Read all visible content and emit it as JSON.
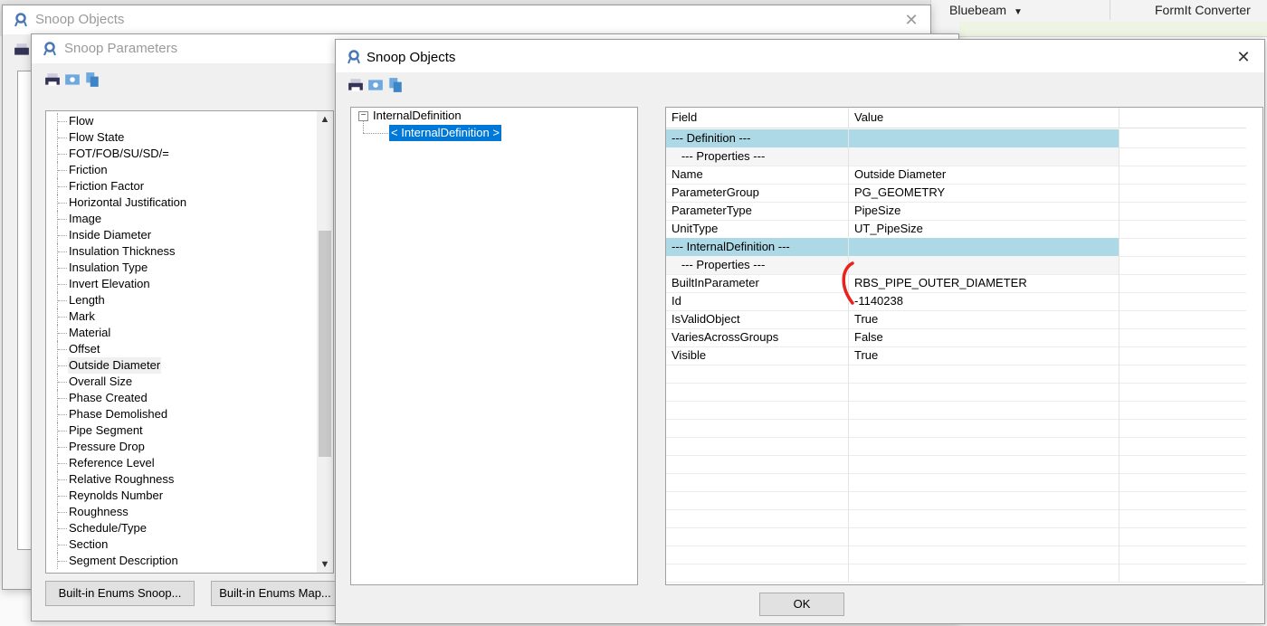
{
  "background": {
    "ribbon_tabs": [
      "Bluebeam",
      "FormIt Converter"
    ]
  },
  "back_window": {
    "title": "Snoop Objects",
    "close": "✕"
  },
  "params_window": {
    "title": "Snoop Parameters",
    "items": [
      "Flow",
      "Flow State",
      "FOT/FOB/SU/SD/=",
      "Friction",
      "Friction Factor",
      "Horizontal Justification",
      "Image",
      "Inside Diameter",
      "Insulation Thickness",
      "Insulation Type",
      "Invert Elevation",
      "Length",
      "Mark",
      "Material",
      "Offset",
      "Outside Diameter",
      "Overall Size",
      "Phase Created",
      "Phase Demolished",
      "Pipe Segment",
      "Pressure Drop",
      "Reference Level",
      "Relative Roughness",
      "Reynolds Number",
      "Roughness",
      "Schedule/Type",
      "Section",
      "Segment Description"
    ],
    "selected_index": 15,
    "buttons": {
      "enums_snoop": "Built-in Enums Snoop...",
      "enums_map": "Built-in Enums Map..."
    }
  },
  "main_window": {
    "title": "Snoop Objects",
    "close": "✕",
    "tree": {
      "root": "InternalDefinition",
      "child": "< InternalDefinition >",
      "expander": "−"
    },
    "grid": {
      "headers": [
        "Field",
        "Value"
      ],
      "rows": [
        {
          "type": "section",
          "field": "--- Definition ---",
          "value": ""
        },
        {
          "type": "subsection",
          "field": "   --- Properties ---",
          "value": ""
        },
        {
          "type": "row",
          "field": "Name",
          "value": "Outside Diameter"
        },
        {
          "type": "row",
          "field": "ParameterGroup",
          "value": "PG_GEOMETRY"
        },
        {
          "type": "row",
          "field": "ParameterType",
          "value": "PipeSize"
        },
        {
          "type": "row",
          "field": "UnitType",
          "value": "UT_PipeSize"
        },
        {
          "type": "section",
          "field": "--- InternalDefinition ---",
          "value": ""
        },
        {
          "type": "subsection",
          "field": "   --- Properties ---",
          "value": ""
        },
        {
          "type": "row",
          "field": "BuiltInParameter",
          "value": "RBS_PIPE_OUTER_DIAMETER"
        },
        {
          "type": "row",
          "field": "Id",
          "value": "-1140238"
        },
        {
          "type": "row",
          "field": "IsValidObject",
          "value": "True"
        },
        {
          "type": "row",
          "field": "VariesAcrossGroups",
          "value": "False"
        },
        {
          "type": "row",
          "field": "Visible",
          "value": "True"
        }
      ],
      "empty_rows": 12
    },
    "ok_label": "OK",
    "annotation_color": "#e8231e"
  },
  "colors": {
    "selection_blue": "#0078d7",
    "section_blue": "#add8e6"
  }
}
